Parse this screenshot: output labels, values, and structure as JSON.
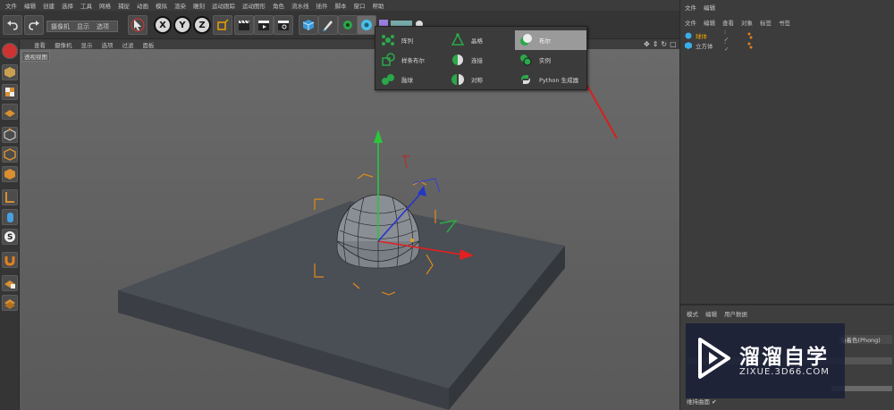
{
  "menubar": {
    "items": [
      "文件",
      "编辑",
      "创建",
      "选择",
      "工具",
      "网格",
      "捕捉",
      "动画",
      "模拟",
      "渲染",
      "雕刻",
      "运动跟踪",
      "运动图形",
      "角色",
      "流水线",
      "插件",
      "脚本",
      "窗口",
      "帮助"
    ]
  },
  "camera_popup": {
    "items": [
      "摄像机",
      "显示",
      "选项"
    ]
  },
  "xyz_buttons": [
    "X",
    "Y",
    "Z"
  ],
  "viewport": {
    "menu": [
      "查看",
      "摄像机",
      "显示",
      "选项",
      "过滤",
      "面板"
    ],
    "label": "透视视图",
    "nav_icons": [
      "✥",
      "⇕",
      "↻",
      "▢"
    ]
  },
  "dropdown": {
    "items": [
      {
        "label": "阵列",
        "icon": "array-icon",
        "color": "#2aa84a"
      },
      {
        "label": "晶格",
        "icon": "atom-icon",
        "color": "#2aa84a"
      },
      {
        "label": "布尔",
        "icon": "boolean-icon",
        "color": "#2aa84a"
      },
      {
        "label": "样条布尔",
        "icon": "spline-boolean-icon",
        "color": "#2aa84a"
      },
      {
        "label": "连接",
        "icon": "connect-icon",
        "color": "#2aa84a"
      },
      {
        "label": "实例",
        "icon": "instance-icon",
        "color": "#2aa84a"
      },
      {
        "label": "融球",
        "icon": "metaball-icon",
        "color": "#2aa84a"
      },
      {
        "label": "对称",
        "icon": "symmetry-icon",
        "color": "#2aa84a"
      },
      {
        "label": "Python 生成器",
        "icon": "python-icon",
        "color": "#2aa84a"
      }
    ],
    "selected": "布尔"
  },
  "object_manager": {
    "menu": [
      "文件",
      "编辑",
      "查看",
      "对象",
      "标签",
      "书签"
    ],
    "objects": [
      {
        "name": "球体",
        "color": "#f0a500"
      },
      {
        "name": "立方体",
        "color": "#c8c8c8"
      }
    ]
  },
  "attribute_manager": {
    "menu": [
      "模式",
      "编辑",
      "用户数据"
    ],
    "phong": "备着色(Phong)",
    "bottom_label": "维持曲面 ✔"
  },
  "watermark": {
    "title": "溜溜自学",
    "url": "ZIXUE.3D66.COM"
  },
  "colors": {
    "accent": "#3aaee8",
    "selection": "#9a9a9a",
    "sphere_tag": "#f0a500"
  }
}
